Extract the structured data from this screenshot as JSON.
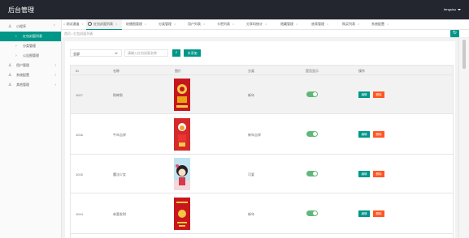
{
  "app": {
    "title": "后台管理",
    "user": "fengsisu"
  },
  "sidebar": {
    "items": [
      {
        "label": "小程序",
        "icon": "user-icon",
        "expanded": true,
        "sub": [
          {
            "label": "红包封面列表",
            "active": true
          },
          {
            "label": "分类管理",
            "active": false
          },
          {
            "label": "公告图管理",
            "active": false
          }
        ]
      },
      {
        "label": "用户管理",
        "icon": "user-icon"
      },
      {
        "label": "系统配置",
        "icon": "user-icon"
      },
      {
        "label": "其他管理",
        "icon": "user-icon"
      }
    ]
  },
  "tabs": [
    {
      "label": "测试通道",
      "active": false
    },
    {
      "label": "红包封面列表",
      "active": true
    },
    {
      "label": "轮播图管理",
      "active": false
    },
    {
      "label": "分类管理",
      "active": false
    },
    {
      "label": "用户列表",
      "active": false
    },
    {
      "label": "卡密列表",
      "active": false
    },
    {
      "label": "分享码统计",
      "active": false
    },
    {
      "label": "隐藏管理",
      "active": false
    },
    {
      "label": "底表管理",
      "active": false
    },
    {
      "label": "购买列表",
      "active": false
    },
    {
      "label": "系统配置",
      "active": false
    }
  ],
  "breadcrumb": "首页 / 红包封面列表",
  "filter": {
    "select_value": "全部",
    "search_placeholder": "请输入红包封面名称",
    "add_label": "添加"
  },
  "table": {
    "headers": [
      "ID",
      "名称",
      "图片",
      "分类",
      "是否显示",
      "操作"
    ],
    "edit_label": "编辑",
    "delete_label": "删除",
    "rows": [
      {
        "id": "1017",
        "name": "财神到",
        "category": "新年",
        "enabled": true
      },
      {
        "id": "1016",
        "name": "牛年吉祥",
        "category": "新年吉祥",
        "enabled": true
      },
      {
        "id": "1015",
        "name": "魔法少女",
        "category": "可爱",
        "enabled": true
      },
      {
        "id": "1014",
        "name": "恭喜发财",
        "category": "新年",
        "enabled": true
      }
    ]
  },
  "colors": {
    "accent": "#009688",
    "danger": "#ff5722",
    "toggle": "#5fb878",
    "topbar": "#23262e"
  }
}
